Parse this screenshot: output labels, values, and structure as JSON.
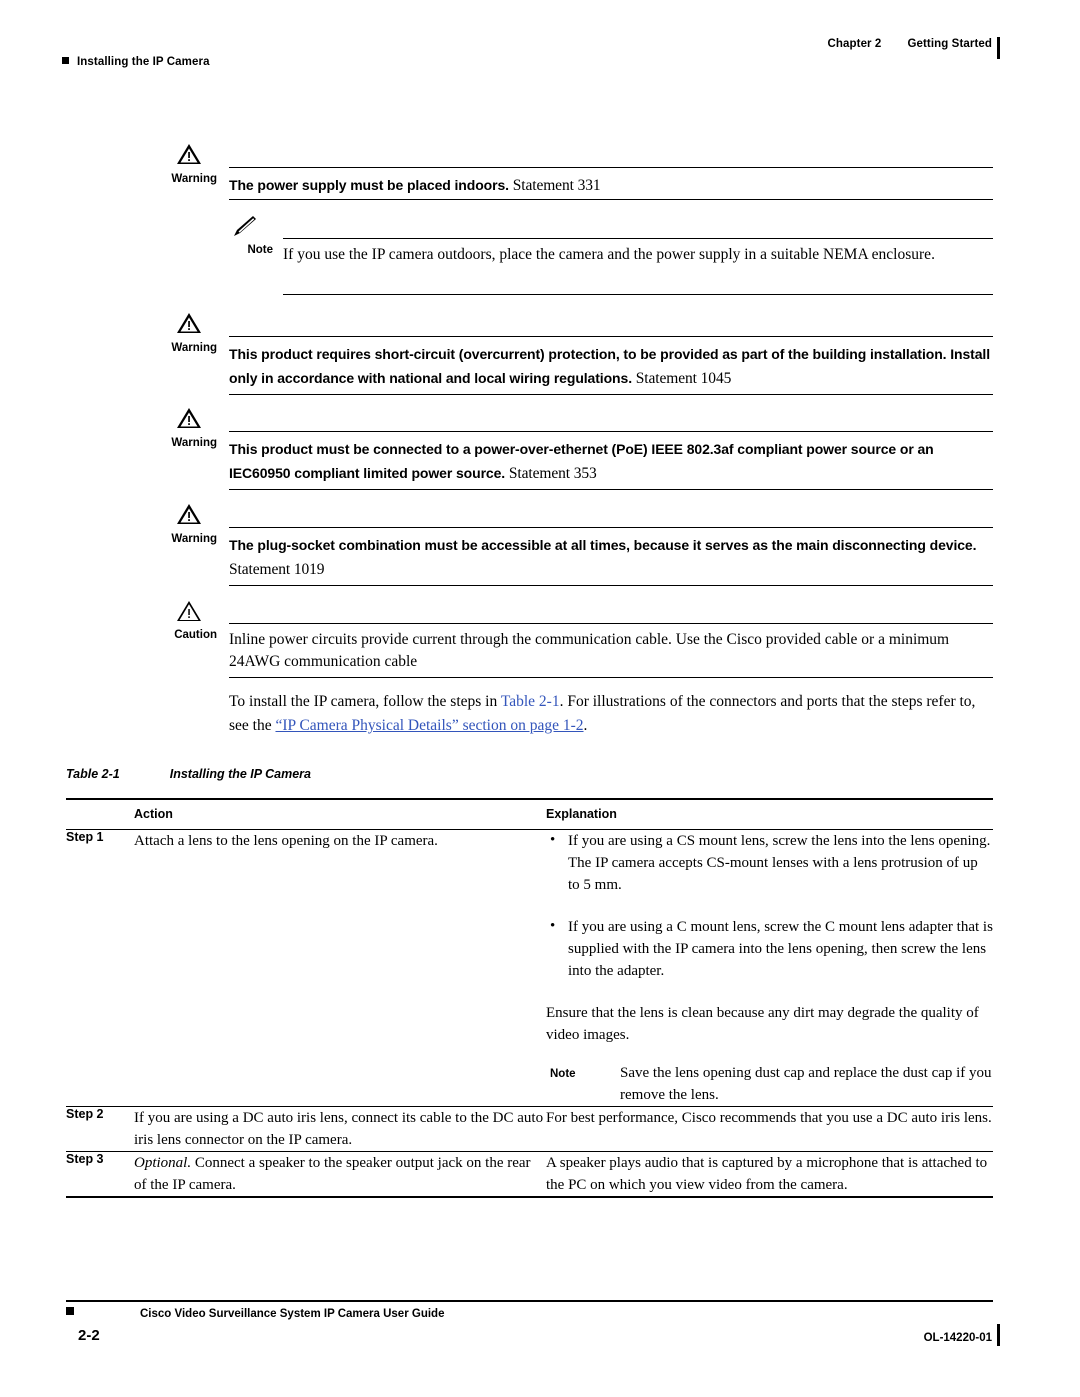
{
  "header": {
    "left_marker_icon": "black-square-icon",
    "left_title": "Installing the IP Camera",
    "chapter": "Chapter 2",
    "chapter_title": "Getting Started"
  },
  "admonitions": [
    {
      "icon": "warning-triangle-icon",
      "label": "Warning",
      "bold_text": "The power supply must be placed indoors.",
      "statement": "Statement 331"
    },
    {
      "icon": "note-pencil-icon",
      "label": "Note",
      "text": "If you use the IP camera outdoors, place the camera and the power supply in a suitable NEMA enclosure."
    },
    {
      "icon": "warning-triangle-icon",
      "label": "Warning",
      "bold_text": "This product requires short-circuit (overcurrent) protection, to be provided as part of the building installation. Install only in accordance with national and local wiring regulations.",
      "statement": "Statement 1045"
    },
    {
      "icon": "warning-triangle-icon",
      "label": "Warning",
      "bold_text": "This product must be connected to a power-over-ethernet (PoE) IEEE 802.3af compliant power source or an IEC60950 compliant limited power source.",
      "statement": "Statement 353"
    },
    {
      "icon": "warning-triangle-icon",
      "label": "Warning",
      "bold_text": "The plug-socket combination must be accessible at all times, because it serves as the main disconnecting device.",
      "statement": "Statement 1019"
    },
    {
      "icon": "caution-triangle-icon",
      "label": "Caution",
      "text": "Inline power circuits provide current through the communication cable. Use the Cisco provided cable or a minimum 24AWG communication cable"
    }
  ],
  "intro": {
    "part1": "To install the IP camera, follow the steps in ",
    "link_table": "Table 2-1",
    "part2": ". For illustrations of the connectors and ports that the steps refer to, see the ",
    "link_section": "“IP Camera Physical Details” section on page 1-2",
    "part3": "."
  },
  "table": {
    "caption_number": "Table 2-1",
    "caption_title": "Installing the IP Camera",
    "columns": [
      "",
      "Action",
      "Explanation"
    ],
    "rows": [
      {
        "step": "Step 1",
        "action": "Attach a lens to the lens opening on the IP camera.",
        "explanation": {
          "bullets": [
            "If you are using a CS mount lens, screw the lens into the lens opening. The IP camera accepts CS-mount lenses with a lens protrusion of up to 5 mm.",
            "If you are using a C mount lens, screw the C mount lens adapter that is supplied with the IP camera into the lens opening, then screw the lens into the adapter."
          ],
          "paragraph": "Ensure that the lens is clean because any dirt may degrade the quality of video images.",
          "note_label": "Note",
          "note_text": "Save the lens opening dust cap and replace the dust cap if you remove the lens."
        }
      },
      {
        "step": "Step 2",
        "action": "If you are using a DC auto iris lens, connect its cable to the DC auto iris lens connector on the IP camera.",
        "explanation": {
          "paragraph": "For best performance, Cisco recommends that you use a DC auto iris lens."
        }
      },
      {
        "step": "Step 3",
        "action_italic": "Optional.",
        "action": " Connect a speaker to the speaker output jack on the rear of the IP camera.",
        "explanation": {
          "paragraph": "A speaker plays audio that is captured by a microphone that is attached to the PC on which you view video from the camera."
        }
      }
    ]
  },
  "footer": {
    "page_number": "2-2",
    "doc_title": "Cisco Video Surveillance System IP Camera User Guide",
    "doc_id": "OL-14220-01"
  }
}
